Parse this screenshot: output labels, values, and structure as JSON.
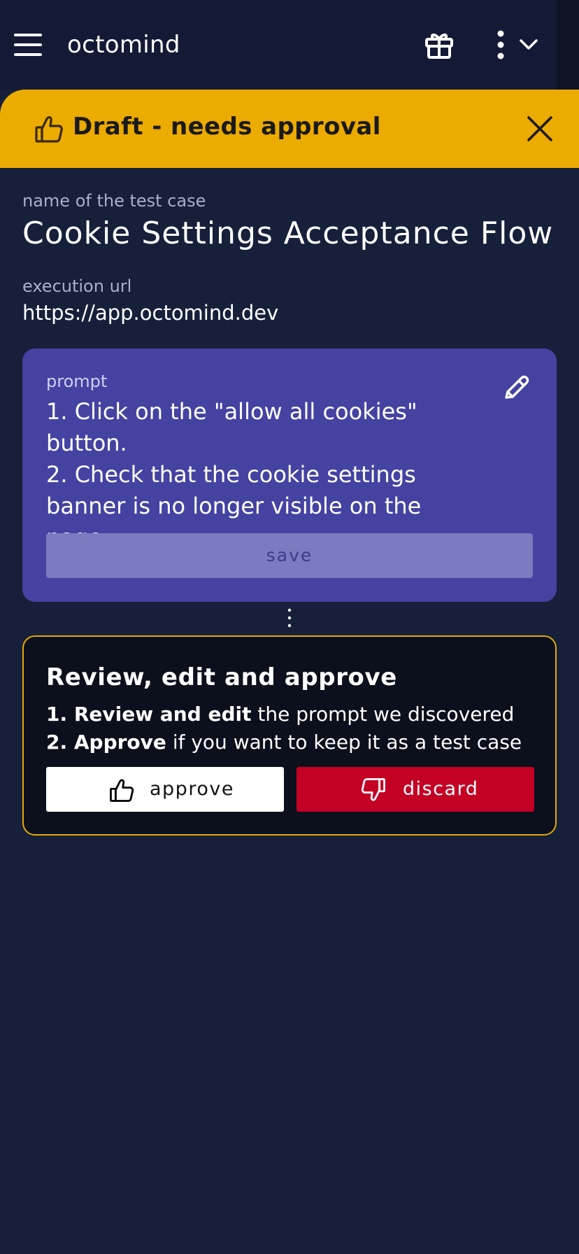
{
  "app": {
    "title": "octomind"
  },
  "header": {
    "menu_icon": "hamburger-menu-icon",
    "gift_icon": "gift-icon",
    "more_icon": "kebab-menu-icon",
    "dropdown_icon": "chevron-down-icon"
  },
  "banner": {
    "text": "Draft - needs approval",
    "icon": "thumbs-up-icon",
    "close_icon": "close-icon",
    "color": "#ecab00"
  },
  "test_case": {
    "name_label": "name of the test case",
    "name": "Cookie Settings Acceptance Flow",
    "url_label": "execution url",
    "url": "https://app.octomind.dev"
  },
  "prompt": {
    "label": "prompt",
    "text": "1. Click on the \"allow all cookies\" button.\n2. Check that the cookie settings banner is no longer visible on the page.",
    "edit_icon": "pencil-icon",
    "save_label": "save",
    "card_color": "#4443a2"
  },
  "review": {
    "title": "Review, edit and approve",
    "step1_bold": "1. Review and edit",
    "step1_rest": " the prompt we discovered",
    "step2_bold": "2. Approve",
    "step2_rest": " if you want to keep it as a test case",
    "approve_label": "approve",
    "discard_label": "discard",
    "discard_color": "#c50025",
    "border_color": "#e5a800"
  },
  "colors": {
    "background": "#16203a",
    "topbar": "#141a35"
  }
}
